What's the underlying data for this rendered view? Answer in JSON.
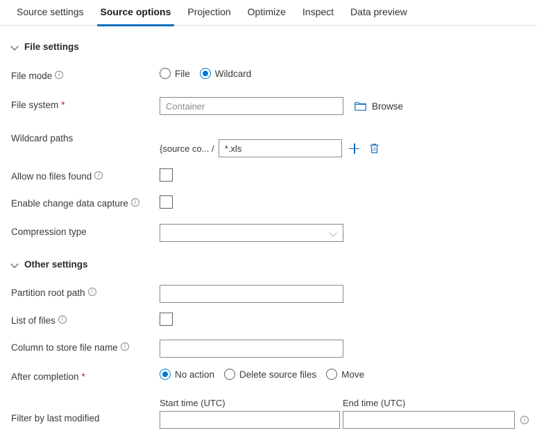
{
  "tabs": [
    {
      "label": "Source settings",
      "active": false
    },
    {
      "label": "Source options",
      "active": true
    },
    {
      "label": "Projection",
      "active": false
    },
    {
      "label": "Optimize",
      "active": false
    },
    {
      "label": "Inspect",
      "active": false
    },
    {
      "label": "Data preview",
      "active": false
    }
  ],
  "file_settings": {
    "header": "File settings",
    "file_mode": {
      "label": "File mode",
      "options": [
        {
          "label": "File",
          "selected": false
        },
        {
          "label": "Wildcard",
          "selected": true
        }
      ]
    },
    "file_system": {
      "label": "File system",
      "required_marker": "*",
      "placeholder": "Container",
      "value": "",
      "browse_label": "Browse"
    },
    "wildcard_paths": {
      "label": "Wildcard paths",
      "prefix": "{source co... /",
      "value": "*.xls",
      "add_label": "+",
      "delete_label": "delete"
    },
    "allow_no_files_found": {
      "label": "Allow no files found",
      "checked": false
    },
    "enable_change_data_capture": {
      "label": "Enable change data capture",
      "checked": false
    },
    "compression_type": {
      "label": "Compression type",
      "value": ""
    }
  },
  "other_settings": {
    "header": "Other settings",
    "partition_root_path": {
      "label": "Partition root path",
      "value": ""
    },
    "list_of_files": {
      "label": "List of files",
      "checked": false
    },
    "column_to_store_file_name": {
      "label": "Column to store file name",
      "value": ""
    },
    "after_completion": {
      "label": "After completion",
      "required_marker": "*",
      "options": [
        {
          "label": "No action",
          "selected": true
        },
        {
          "label": "Delete source files",
          "selected": false
        },
        {
          "label": "Move",
          "selected": false
        }
      ]
    },
    "filter_by_last_modified": {
      "label": "Filter by last modified",
      "start_time_label": "Start time (UTC)",
      "end_time_label": "End time (UTC)",
      "start_time_value": "",
      "end_time_value": ""
    }
  },
  "colors": {
    "accent": "#0f6cbd",
    "radio_selected": "#0078d4",
    "required": "#a4262c",
    "label_text": "#3b3a39",
    "border": "#8a8886"
  }
}
